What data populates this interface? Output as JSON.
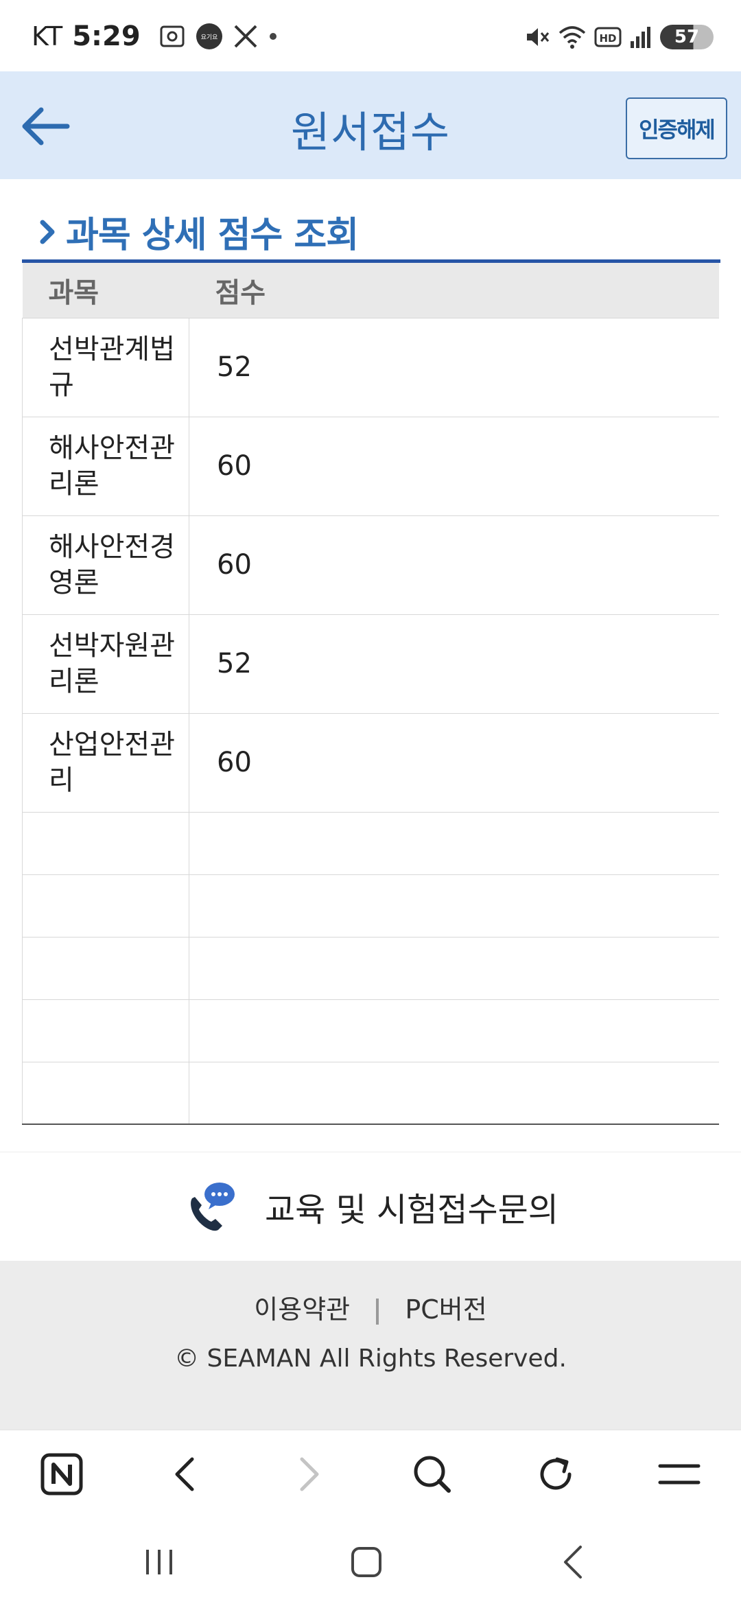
{
  "status_bar": {
    "carrier": "KT",
    "time": "5:29",
    "notification_badge": "요기요",
    "battery": "57"
  },
  "header": {
    "title": "원서접수",
    "cert_button": "인증해제"
  },
  "section": {
    "title": "과목 상세 점수 조회"
  },
  "table": {
    "headers": [
      "과목",
      "점수"
    ],
    "rows": [
      {
        "subject": "선박관계법규",
        "score": "52"
      },
      {
        "subject": "해사안전관리론",
        "score": "60"
      },
      {
        "subject": "해사안전경영론",
        "score": "60"
      },
      {
        "subject": "선박자원관리론",
        "score": "52"
      },
      {
        "subject": "산업안전관리",
        "score": "60"
      }
    ]
  },
  "inquiry": {
    "label": "교육 및 시험접수문의",
    "icon": "phone-chat-icon"
  },
  "footer": {
    "terms": "이용약관",
    "pc_version": "PC버전",
    "copyright": "© SEAMAN All Rights Reserved."
  },
  "colors": {
    "header_bg": "#dce9f9",
    "accent": "#2f6fb6",
    "section_line": "#2755a6",
    "footer_bg": "#ececec"
  }
}
